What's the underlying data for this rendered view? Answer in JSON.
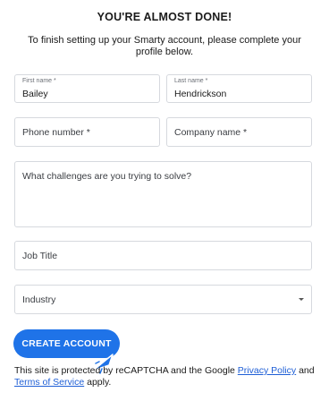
{
  "form": {
    "heading": "YOU'RE ALMOST DONE!",
    "subtitle": "To finish setting up your Smarty account, please complete your profile below."
  },
  "fields": {
    "first_name": {
      "label": "First name *",
      "value": "Bailey"
    },
    "last_name": {
      "label": "Last name *",
      "value": "Hendrickson"
    },
    "phone": {
      "placeholder": "Phone number *"
    },
    "company": {
      "placeholder": "Company name *"
    },
    "challenges": {
      "placeholder": "What challenges are you trying to solve?"
    },
    "job_title": {
      "placeholder": "Job Title"
    },
    "industry": {
      "placeholder": "Industry",
      "icon": "chevron-down-icon"
    }
  },
  "cta": {
    "label": "CREATE ACCOUNT",
    "color": "#1f73e8"
  },
  "legal": {
    "prefix": "This site is protected by reCAPTCHA and the Google ",
    "privacy_link": "Privacy Policy",
    "middle": " and ",
    "terms_link": "Terms of Service",
    "suffix": " apply."
  },
  "colors": {
    "link": "#1f5fd6",
    "border": "#d6d9de"
  }
}
